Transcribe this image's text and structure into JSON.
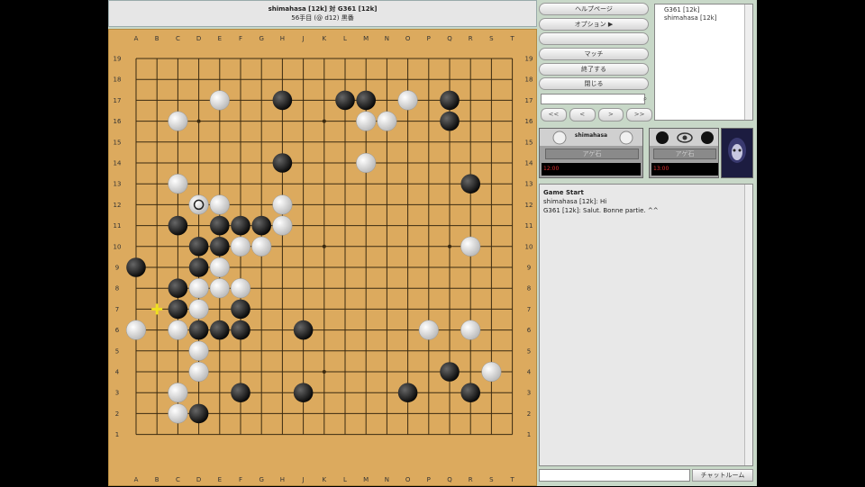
{
  "header": {
    "title": "shimahasa [12k] 対 G361 [12k]",
    "subtitle": "56手目 (@ d12) 黒番"
  },
  "board": {
    "size": 19,
    "columns": [
      "A",
      "B",
      "C",
      "D",
      "E",
      "F",
      "G",
      "H",
      "J",
      "K",
      "L",
      "M",
      "N",
      "O",
      "P",
      "Q",
      "R",
      "S",
      "T"
    ],
    "last_move": "D12",
    "marker": "B7",
    "black": [
      "H17",
      "L17",
      "M17",
      "Q17",
      "Q16",
      "H14",
      "R13",
      "C11",
      "E11",
      "F11",
      "G11",
      "D10",
      "E10",
      "D9",
      "A9",
      "C8",
      "C7",
      "F7",
      "D6",
      "E6",
      "F6",
      "J6",
      "Q4",
      "F3",
      "J3",
      "O3",
      "R3",
      "D2"
    ],
    "white": [
      "E17",
      "O17",
      "C16",
      "M16",
      "N16",
      "M14",
      "C13",
      "D12",
      "E12",
      "H12",
      "H11",
      "F10",
      "G10",
      "R10",
      "E9",
      "D8",
      "E8",
      "F8",
      "D7",
      "A6",
      "C6",
      "P6",
      "R6",
      "D5",
      "D4",
      "S4",
      "C3",
      "C2"
    ]
  },
  "menu": {
    "buttons": [
      "ヘルプページ",
      "オプション ▶",
      "",
      "マッチ",
      "終了する",
      "閉じる"
    ],
    "nav": [
      "<<",
      "<",
      ">",
      ">>"
    ],
    "search_icon": "magnifier-icon"
  },
  "userlist": [
    "G361 [12k]",
    "shimahasa [12k]"
  ],
  "players": {
    "white_name": "shimahasa",
    "white_button": "アゲ石",
    "white_score": "12:00",
    "black_button": "アゲ石",
    "black_score": "13:00"
  },
  "chat": {
    "lines": [
      {
        "text": "Game Start",
        "bold": true
      },
      {
        "text": "shimahasa [12k]: Hi",
        "bold": false
      },
      {
        "text": "G361 [12k]: Salut. Bonne partie. ^^",
        "bold": false
      }
    ],
    "button": "チャットルーム"
  }
}
